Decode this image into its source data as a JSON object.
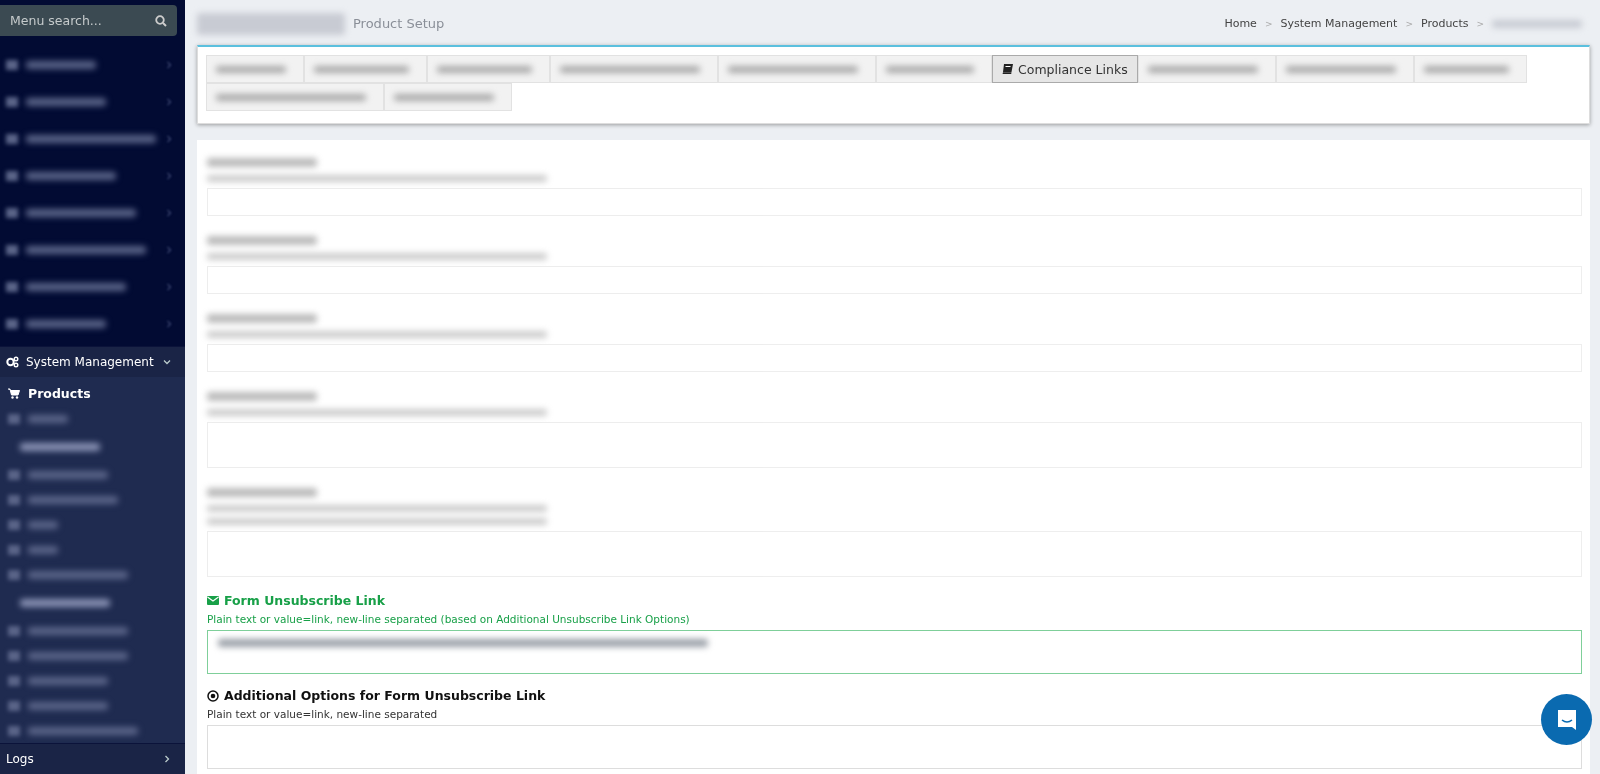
{
  "sidebar": {
    "search": {
      "placeholder": "Menu search..."
    },
    "items": [
      {
        "kind": "redacted"
      },
      {
        "kind": "redacted"
      },
      {
        "kind": "redacted"
      },
      {
        "kind": "redacted"
      },
      {
        "kind": "redacted"
      },
      {
        "kind": "redacted"
      },
      {
        "kind": "redacted"
      },
      {
        "kind": "redacted"
      },
      {
        "kind": "menu",
        "label": "System Management",
        "expanded": true,
        "children": [
          {
            "kind": "item",
            "label": "Products",
            "selected": true
          },
          {
            "kind": "redacted",
            "selected": false
          },
          {
            "kind": "redacted-group",
            "selected": false
          },
          {
            "kind": "redacted",
            "selected": false
          },
          {
            "kind": "redacted",
            "selected": false
          },
          {
            "kind": "redacted",
            "selected": false
          },
          {
            "kind": "redacted",
            "selected": false
          },
          {
            "kind": "redacted",
            "selected": false
          },
          {
            "kind": "redacted-group",
            "selected": false
          },
          {
            "kind": "redacted",
            "selected": false
          },
          {
            "kind": "redacted",
            "selected": false
          },
          {
            "kind": "redacted",
            "selected": false
          },
          {
            "kind": "redacted",
            "selected": false
          },
          {
            "kind": "redacted",
            "selected": false
          }
        ]
      },
      {
        "kind": "menu",
        "label": "Logs",
        "expanded": false
      }
    ]
  },
  "header": {
    "subtitle": "Product Setup",
    "breadcrumb": {
      "separator": ">",
      "items": [
        {
          "kind": "link",
          "label": "Home"
        },
        {
          "kind": "link",
          "label": "System Management"
        },
        {
          "kind": "link",
          "label": "Products"
        },
        {
          "kind": "redacted"
        }
      ]
    }
  },
  "tabs": [
    {
      "selected": false
    },
    {
      "selected": false
    },
    {
      "selected": false
    },
    {
      "selected": false
    },
    {
      "selected": false
    },
    {
      "selected": false
    },
    {
      "label": "Compliance Links",
      "selected": true
    },
    {
      "selected": false
    },
    {
      "selected": false
    },
    {
      "selected": false
    },
    {
      "selected": false
    },
    {
      "selected": false
    }
  ],
  "fields": [
    {
      "kind": "redacted"
    },
    {
      "kind": "redacted"
    },
    {
      "kind": "redacted"
    },
    {
      "kind": "redacted"
    },
    {
      "kind": "redacted"
    },
    {
      "kind": "unsubscribe",
      "label": "Form Unsubscribe Link",
      "hint": "Plain text or value=link, new-line separated (based on Additional Unsubscribe Link Options)",
      "focused": true
    },
    {
      "kind": "options",
      "label": "Additional Options for Form Unsubscribe Link",
      "hint": "Plain text or value=link, new-line separated",
      "focused": false
    }
  ]
}
